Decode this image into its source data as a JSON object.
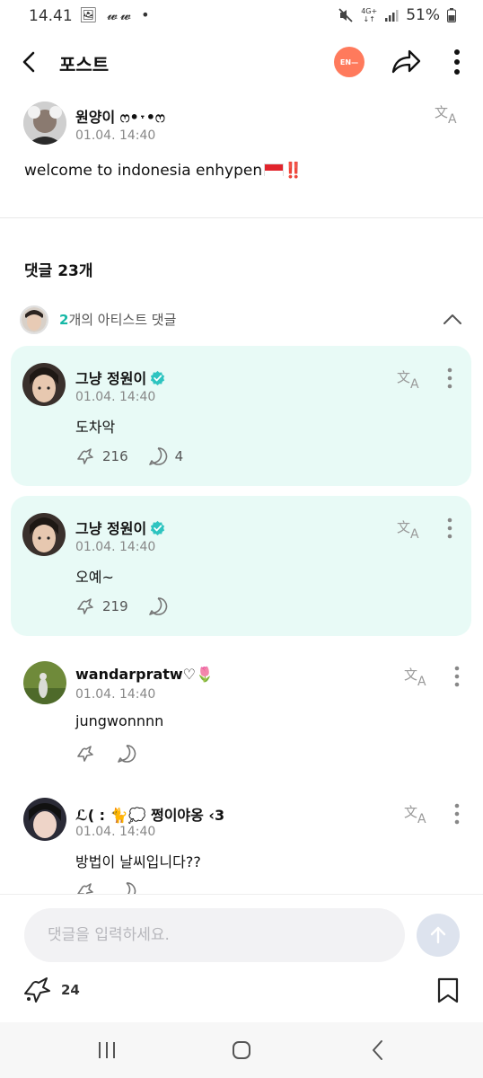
{
  "status": {
    "time": "14.41",
    "left_icons": "🖼 𝔀𝔀 •",
    "mute_icon": "mute-icon",
    "network": "4G+",
    "battery": "51%"
  },
  "header": {
    "title": "포스트",
    "lang_badge": "EN—"
  },
  "post": {
    "author": "원양이 ෆ•˕•ෆ",
    "time": "01.04. 14:40",
    "body": "welcome to indonesia enhypen",
    "emphasis": "‼️"
  },
  "comments_header": {
    "count_label": "댓글 23개"
  },
  "artist_summary": {
    "count": "2",
    "label": "개의 아티스트 댓글"
  },
  "artist_comments": [
    {
      "name": "그냥 정원이",
      "time": "01.04. 14:40",
      "text": "도차악",
      "likes": "216",
      "replies": "4"
    },
    {
      "name": "그냥 정원이",
      "time": "01.04. 14:40",
      "text": "오예~",
      "likes": "219",
      "replies": ""
    }
  ],
  "comments": [
    {
      "name": "wandarpratw♡🌷",
      "time": "01.04. 14:40",
      "text": "jungwonnnn"
    },
    {
      "name": "ℒ( : 🐈💭 쩡이야옹 ‹3",
      "time": "01.04. 14:40",
      "text": "방법이 날씨입니다??"
    }
  ],
  "composer": {
    "placeholder": "댓글을 입력하세요.",
    "like_count": "24"
  },
  "colors": {
    "accent": "#16b8a6",
    "artist_bg": "#e8faf6",
    "badge": "#ff7a5c"
  }
}
